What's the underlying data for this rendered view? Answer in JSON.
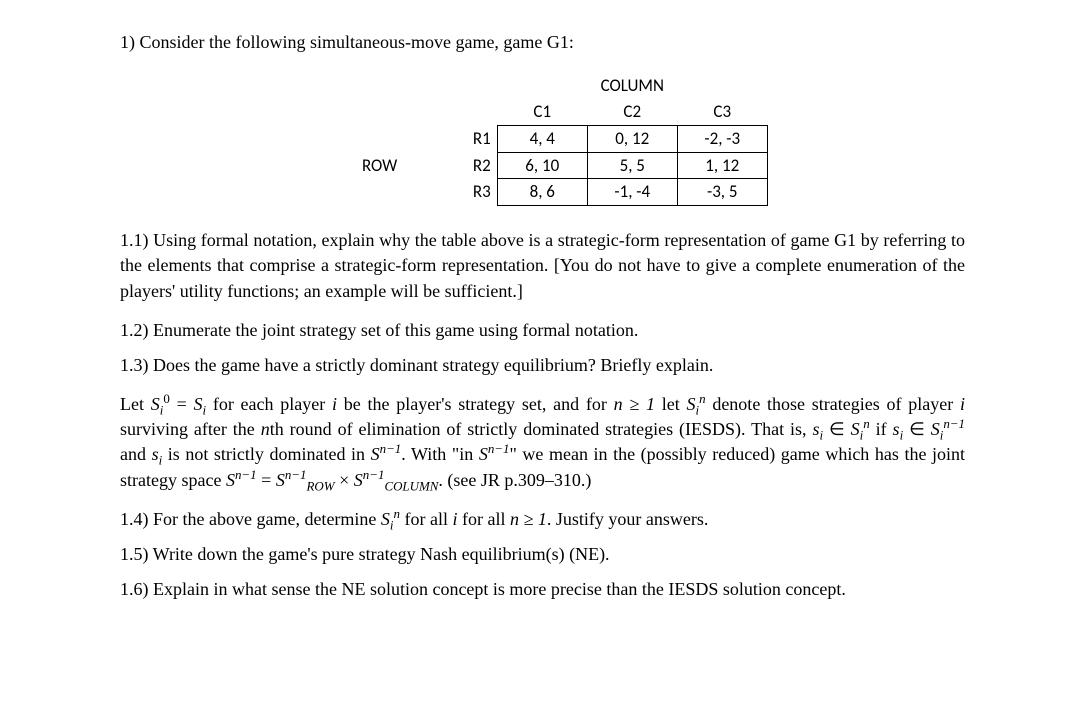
{
  "intro": "1) Consider the following simultaneous-move game, game G1:",
  "table": {
    "column_player": "COLUMN",
    "row_player": "ROW",
    "col_headers": [
      "C1",
      "C2",
      "C3"
    ],
    "row_headers": [
      "R1",
      "R2",
      "R3"
    ],
    "payoffs": {
      "r1": [
        "4, 4",
        "0, 12",
        "-2, -3"
      ],
      "r2": [
        "6, 10",
        "5, 5",
        "1, 12"
      ],
      "r3": [
        "8, 6",
        "-1, -4",
        "-3, 5"
      ]
    }
  },
  "q11": "1.1) Using formal notation, explain why the table above is a strategic-form representation of game G1 by referring to the elements that comprise a strategic-form representation. [You do not have to give a complete enumeration of the players' utility functions; an example will be sufficient.]",
  "q12": "1.2) Enumerate the joint strategy set of this game using formal notation.",
  "q13": "1.3) Does the game have a strictly dominant strategy equilibrium? Briefly explain.",
  "iesds": {
    "p1a": "Let ",
    "p1b": " for each player ",
    "p1c": " be the player's strategy set, and for ",
    "p1d": " let ",
    "p1e": " denote those strategies of player ",
    "p1f": " surviving after the ",
    "p1g": "th round of elimination of strictly dominated strategies (IESDS). That is, ",
    "p1h": " if ",
    "p1i": " and ",
    "p1j": " is not strictly dominated in ",
    "p1k": ". With \"in ",
    "p1l": "\" we mean in the (possibly reduced) game which has the joint strategy space ",
    "p1m": ". (see JR p.309–310.)",
    "s0": "S",
    "eq": " = ",
    "si": "S",
    "i": "i",
    "n": "n",
    "nge1": "n ≥ 1",
    "sin": "S",
    "el": " ∈ ",
    "s_small": "s",
    "nm1": "n−1",
    "Snm1": "S",
    "times": " × ",
    "row": "ROW",
    "col": "COLUMN"
  },
  "q14a": "1.4) For the above game, determine ",
  "q14b": " for all ",
  "q14c": " for all ",
  "q14d": ". Justify your answers.",
  "q15": "1.5) Write down the game's pure strategy Nash equilibrium(s) (NE).",
  "q16": "1.6) Explain in what sense the NE solution concept is more precise than the IESDS solution concept."
}
